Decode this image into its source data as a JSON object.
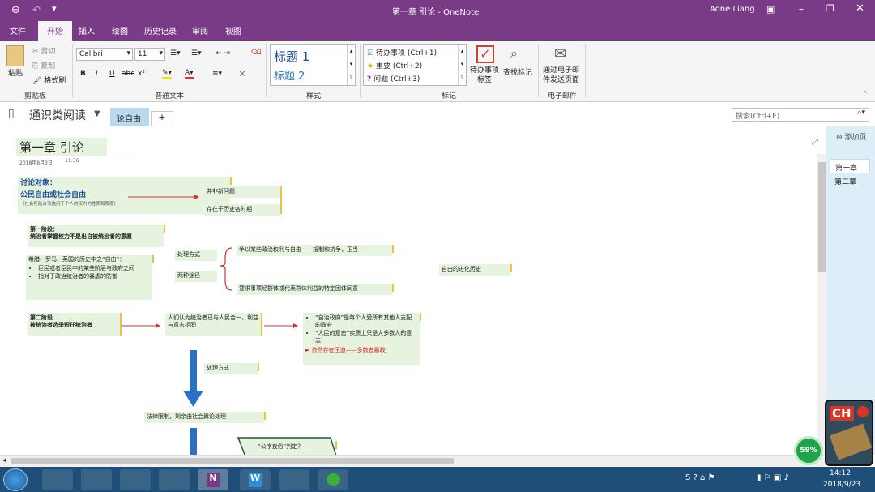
{
  "window": {
    "title": "第一章 引论 - OneNote",
    "user": "Aone Liang"
  },
  "ribbon_tabs": [
    {
      "label": "文件",
      "active": false
    },
    {
      "label": "开始",
      "active": true
    },
    {
      "label": "插入",
      "active": false
    },
    {
      "label": "绘图",
      "active": false
    },
    {
      "label": "历史记录",
      "active": false
    },
    {
      "label": "审阅",
      "active": false
    },
    {
      "label": "视图",
      "active": false
    }
  ],
  "ribbon": {
    "clipboard": {
      "paste": "粘贴",
      "cut": "剪切",
      "copy": "复制",
      "format_painter": "格式刷",
      "group": "剪贴板"
    },
    "font": {
      "name": "Calibri",
      "size": "11",
      "bold": "B",
      "italic": "I",
      "underline": "U",
      "strike": "abc",
      "superscript": "x²",
      "group": "普通文本"
    },
    "styles": {
      "h1": "标题 1",
      "h2": "标题 2",
      "group": "样式"
    },
    "tags": {
      "items": [
        "待办事项 (Ctrl+1)",
        "重要 (Ctrl+2)",
        "问题 (Ctrl+3)"
      ],
      "todo_tag": "待办事项\n标签",
      "find_tags": "查找标记",
      "group": "标记"
    },
    "email": {
      "label": "通过电子邮\n件发送页面",
      "group": "电子邮件"
    }
  },
  "notebook": {
    "name": "通识类阅读",
    "section": "论自由",
    "add_tab": "+",
    "search_placeholder": "搜索(Ctrl+E)"
  },
  "page": {
    "title": "第一章 引论",
    "date": "2018年8月3日",
    "time": "11:36"
  },
  "notes": {
    "topic_label": "讨论对象：",
    "topic": "公民自由或社会自由",
    "topic_sub": "（社会所能合法施用于个人的权力的性质和限度）",
    "new_issue": "并非新问题",
    "always": "存在于历史各时期",
    "stage1_title": "第一阶段：",
    "stage1_text": "统治者掌握权力不是出自被统治者的意愿",
    "history": "希腊、罗马、英国的历史中之“自由”：",
    "history_b1": "臣民或者臣民中的某些阶层与政府之间",
    "history_b2": "指对于政治统治者的暴虐的防御",
    "handling": "处理方式",
    "two_ways": "两种途径",
    "way1": "争以某些政治权利与自由——抵制和抗争，正当",
    "way2": "要求事项经群体或代表群体利益的特定团体同意",
    "evolution": "自由的进化历史",
    "stage2_title": "第二阶段",
    "stage2_text": "被统治者选举短任统治者",
    "stage2_mid": "人们认为统治者已与人民合一，利益与意志相同",
    "stage2_b1": "“自治政府”是每个人受所有其他人支配的政府",
    "stage2_b2": "“人民的意志”实质上只是大多数人的意志",
    "stage2_warn": "依然存在压迫——多数者暴政",
    "handling2": "处理方式",
    "law": "法律限制，剩余由社会舆论处理",
    "question": "“公序良俗”判定？"
  },
  "pages": {
    "add": "添加页",
    "items": [
      "第一章",
      "第二章"
    ]
  },
  "status": {
    "battery_percent": "59%",
    "time": "14:12",
    "date": "2018/9/23",
    "ime": "CH"
  },
  "colors": {
    "purple": "#7a3b86",
    "note_green": "#e5f3df",
    "arrow_red": "#d93030",
    "arrow_blue": "#2d6fc4",
    "warn_red": "#e02020"
  }
}
